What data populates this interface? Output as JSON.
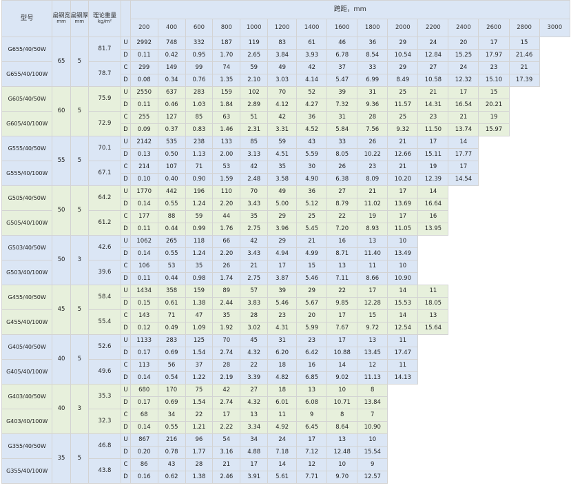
{
  "headers": {
    "model": "型号",
    "width": "扁钢宽度",
    "width_unit": "mm",
    "thickness": "扁钢厚度",
    "thickness_unit": "mm",
    "weight": "理论重量",
    "weight_unit": "kg/m²",
    "span": "跨距，mm",
    "spans": [
      "200",
      "400",
      "600",
      "800",
      "1000",
      "1200",
      "1400",
      "1600",
      "1800",
      "2000",
      "2200",
      "2400",
      "2600",
      "2800",
      "3000"
    ]
  },
  "groups": [
    {
      "color": "blue",
      "width": "65",
      "thickness": "5",
      "models": [
        "G655/40/50W",
        "G655/40/100W"
      ],
      "weights": [
        "81.7",
        "78.7"
      ],
      "rows": [
        [
          "U",
          [
            "2992",
            "748",
            "332",
            "187",
            "119",
            "83",
            "61",
            "46",
            "36",
            "29",
            "24",
            "20",
            "17",
            "15"
          ]
        ],
        [
          "D",
          [
            "0.11",
            "0.42",
            "0.95",
            "1.70",
            "2.65",
            "3.84",
            "3.93",
            "6.78",
            "8.54",
            "10.54",
            "12.84",
            "15.25",
            "17.97",
            "21.46"
          ]
        ],
        [
          "C",
          [
            "299",
            "149",
            "99",
            "74",
            "59",
            "49",
            "42",
            "37",
            "33",
            "29",
            "27",
            "24",
            "23",
            "21"
          ]
        ],
        [
          "D",
          [
            "0.08",
            "0.34",
            "0.76",
            "1.35",
            "2.10",
            "3.03",
            "4.14",
            "5.47",
            "6.99",
            "8.49",
            "10.58",
            "12.32",
            "15.10",
            "17.39"
          ]
        ]
      ]
    },
    {
      "color": "green",
      "width": "60",
      "thickness": "5",
      "models": [
        "G605/40/50W",
        "G605/40/100W"
      ],
      "weights": [
        "75.9",
        "72.9"
      ],
      "rows": [
        [
          "U",
          [
            "2550",
            "637",
            "283",
            "159",
            "102",
            "70",
            "52",
            "39",
            "31",
            "25",
            "21",
            "17",
            "15"
          ]
        ],
        [
          "D",
          [
            "0.11",
            "0.46",
            "1.03",
            "1.84",
            "2.89",
            "4.12",
            "4.27",
            "7.32",
            "9.36",
            "11.57",
            "14.31",
            "16.54",
            "20.21"
          ]
        ],
        [
          "C",
          [
            "255",
            "127",
            "85",
            "63",
            "51",
            "42",
            "36",
            "31",
            "28",
            "25",
            "23",
            "21",
            "19"
          ]
        ],
        [
          "D",
          [
            "0.09",
            "0.37",
            "0.83",
            "1.46",
            "2.31",
            "3.31",
            "4.52",
            "5.84",
            "7.56",
            "9.32",
            "11.50",
            "13.74",
            "15.97"
          ]
        ]
      ]
    },
    {
      "color": "blue",
      "width": "55",
      "thickness": "5",
      "models": [
        "G555/40/50W",
        "G555/40/100W"
      ],
      "weights": [
        "70.1",
        "67.1"
      ],
      "rows": [
        [
          "U",
          [
            "2142",
            "535",
            "238",
            "133",
            "85",
            "59",
            "43",
            "33",
            "26",
            "21",
            "17",
            "14"
          ]
        ],
        [
          "D",
          [
            "0.13",
            "0.50",
            "1.13",
            "2.00",
            "3.13",
            "4.51",
            "5.59",
            "8.05",
            "10.22",
            "12.66",
            "15.11",
            "17.77"
          ]
        ],
        [
          "C",
          [
            "214",
            "107",
            "71",
            "53",
            "42",
            "35",
            "30",
            "26",
            "23",
            "21",
            "19",
            "17"
          ]
        ],
        [
          "D",
          [
            "0.10",
            "0.40",
            "0.90",
            "1.59",
            "2.48",
            "3.58",
            "4.90",
            "6.38",
            "8.09",
            "10.20",
            "12.39",
            "14.54"
          ]
        ]
      ]
    },
    {
      "color": "green",
      "width": "50",
      "thickness": "5",
      "models": [
        "G505/40/50W",
        "G505/40/100W"
      ],
      "weights": [
        "64.2",
        "61.2"
      ],
      "rows": [
        [
          "U",
          [
            "1770",
            "442",
            "196",
            "110",
            "70",
            "49",
            "36",
            "27",
            "21",
            "17",
            "14"
          ]
        ],
        [
          "D",
          [
            "0.14",
            "0.55",
            "1.24",
            "2.20",
            "3.43",
            "5.00",
            "5.12",
            "8.79",
            "11.02",
            "13.69",
            "16.64"
          ]
        ],
        [
          "C",
          [
            "177",
            "88",
            "59",
            "44",
            "35",
            "29",
            "25",
            "22",
            "19",
            "17",
            "16"
          ]
        ],
        [
          "D",
          [
            "0.11",
            "0.44",
            "0.99",
            "1.76",
            "2.75",
            "3.96",
            "5.45",
            "7.20",
            "8.93",
            "11.05",
            "13.95"
          ]
        ]
      ]
    },
    {
      "color": "blue",
      "width": "50",
      "thickness": "3",
      "models": [
        "G503/40/50W",
        "G503/40/100W"
      ],
      "weights": [
        "42.6",
        "39.6"
      ],
      "rows": [
        [
          "U",
          [
            "1062",
            "265",
            "118",
            "66",
            "42",
            "29",
            "21",
            "16",
            "13",
            "10"
          ]
        ],
        [
          "D",
          [
            "0.14",
            "0.55",
            "1.24",
            "2.20",
            "3.43",
            "4.94",
            "4.99",
            "8.71",
            "11.40",
            "13.49"
          ]
        ],
        [
          "C",
          [
            "106",
            "53",
            "35",
            "26",
            "21",
            "17",
            "15",
            "13",
            "11",
            "10"
          ]
        ],
        [
          "D",
          [
            "0.11",
            "0.44",
            "0.98",
            "1.74",
            "2.75",
            "3.87",
            "5.46",
            "7.11",
            "8.66",
            "10.90"
          ]
        ]
      ]
    },
    {
      "color": "green",
      "width": "45",
      "thickness": "5",
      "models": [
        "G455/40/50W",
        "G455/40/100W"
      ],
      "weights": [
        "58.4",
        "55.4"
      ],
      "rows": [
        [
          "U",
          [
            "1434",
            "358",
            "159",
            "89",
            "57",
            "39",
            "29",
            "22",
            "17",
            "14",
            "11"
          ]
        ],
        [
          "D",
          [
            "0.15",
            "0.61",
            "1.38",
            "2.44",
            "3.83",
            "5.46",
            "5.67",
            "9.85",
            "12.28",
            "15.53",
            "18.05"
          ]
        ],
        [
          "C",
          [
            "143",
            "71",
            "47",
            "35",
            "28",
            "23",
            "20",
            "17",
            "15",
            "14",
            "13"
          ]
        ],
        [
          "D",
          [
            "0.12",
            "0.49",
            "1.09",
            "1.92",
            "3.02",
            "4.31",
            "5.99",
            "7.67",
            "9.72",
            "12.54",
            "15.64"
          ]
        ]
      ]
    },
    {
      "color": "blue",
      "width": "40",
      "thickness": "5",
      "models": [
        "G405/40/50W",
        "G405/40/100W"
      ],
      "weights": [
        "52.6",
        "49.6"
      ],
      "rows": [
        [
          "U",
          [
            "1133",
            "283",
            "125",
            "70",
            "45",
            "31",
            "23",
            "17",
            "13",
            "11"
          ]
        ],
        [
          "D",
          [
            "0.17",
            "0.69",
            "1.54",
            "2.74",
            "4.32",
            "6.20",
            "6.42",
            "10.88",
            "13.45",
            "17.47"
          ]
        ],
        [
          "C",
          [
            "113",
            "56",
            "37",
            "28",
            "22",
            "18",
            "16",
            "14",
            "12",
            "11"
          ]
        ],
        [
          "D",
          [
            "0.14",
            "0.54",
            "1.22",
            "2.19",
            "3.39",
            "4.82",
            "6.85",
            "9.02",
            "11.13",
            "14.13"
          ]
        ]
      ]
    },
    {
      "color": "green",
      "width": "40",
      "thickness": "3",
      "models": [
        "G403/40/50W",
        "G403/40/100W"
      ],
      "weights": [
        "35.3",
        "32.3"
      ],
      "rows": [
        [
          "U",
          [
            "680",
            "170",
            "75",
            "42",
            "27",
            "18",
            "13",
            "10",
            "8"
          ]
        ],
        [
          "D",
          [
            "0.17",
            "0.69",
            "1.54",
            "2.74",
            "4.32",
            "6.01",
            "6.08",
            "10.71",
            "13.84"
          ]
        ],
        [
          "C",
          [
            "68",
            "34",
            "22",
            "17",
            "13",
            "11",
            "9",
            "8",
            "7"
          ]
        ],
        [
          "D",
          [
            "0.14",
            "0.55",
            "1.21",
            "2.22",
            "3.34",
            "4.92",
            "6.45",
            "8.64",
            "10.90"
          ]
        ]
      ]
    },
    {
      "color": "blue",
      "width": "35",
      "thickness": "5",
      "models": [
        "G355/40/50W",
        "G355/40/100W"
      ],
      "weights": [
        "46.8",
        "43.8"
      ],
      "rows": [
        [
          "U",
          [
            "867",
            "216",
            "96",
            "54",
            "34",
            "24",
            "17",
            "13",
            "10"
          ]
        ],
        [
          "D",
          [
            "0.20",
            "0.78",
            "1.77",
            "3.16",
            "4.88",
            "7.18",
            "7.12",
            "12.48",
            "15.54"
          ]
        ],
        [
          "C",
          [
            "86",
            "43",
            "28",
            "21",
            "17",
            "14",
            "12",
            "10",
            "9"
          ]
        ],
        [
          "D",
          [
            "0.16",
            "0.62",
            "1.38",
            "2.46",
            "3.91",
            "5.61",
            "7.71",
            "9.70",
            "12.57"
          ]
        ]
      ]
    }
  ]
}
